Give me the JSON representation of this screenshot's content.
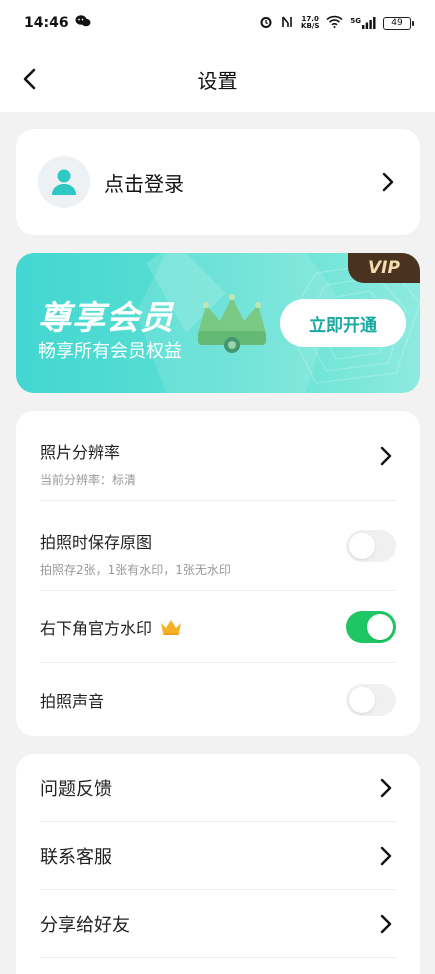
{
  "status_bar": {
    "time": "14:46",
    "net_speed_value": "17.0",
    "net_speed_unit": "KB/S",
    "signal_label": "5G",
    "battery": "49"
  },
  "navbar": {
    "title": "设置"
  },
  "login": {
    "label": "点击登录"
  },
  "vip": {
    "tag": "VIP",
    "title": "尊享会员",
    "subtitle": "畅享所有会员权益",
    "button": "立即开通"
  },
  "settings": {
    "items": [
      {
        "title": "照片分辨率",
        "subtitle": "当前分辨率：标清",
        "control": "chevron"
      },
      {
        "title": "拍照时保存原图",
        "subtitle": "拍照存2张，1张有水印，1张无水印",
        "control": "toggle",
        "on": false
      },
      {
        "title": "右下角官方水印",
        "control": "toggle",
        "on": true,
        "badge": "crown-icon"
      },
      {
        "title": "拍照声音",
        "control": "toggle",
        "on": false
      }
    ]
  },
  "links": {
    "items": [
      {
        "title": "问题反馈"
      },
      {
        "title": "联系客服"
      },
      {
        "title": "分享给好友"
      }
    ]
  },
  "colors": {
    "toggle_on": "#1ec764",
    "vip_gradient_start": "#43d7d2",
    "vip_button_text": "#18a9a0",
    "vip_tag_bg": "#4a3221"
  }
}
